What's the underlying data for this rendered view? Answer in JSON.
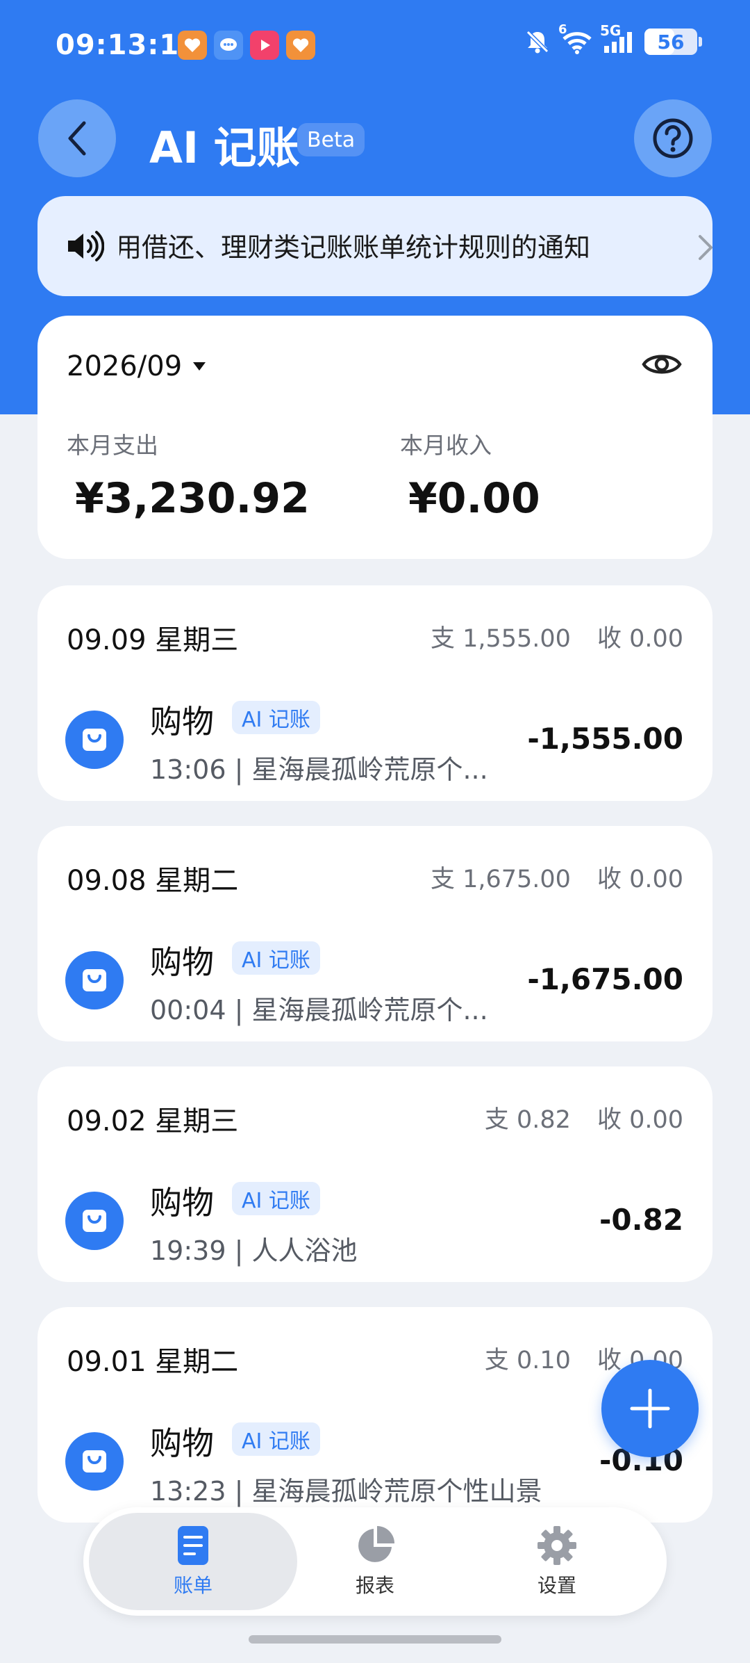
{
  "status_bar": {
    "time": "09:13:13",
    "battery_level": "56",
    "battery_fraction": 0.56,
    "network_label": "5G",
    "wifi_badge": "6",
    "notification_icons": [
      "heart-app-icon",
      "chat-bubble-icon",
      "video-play-icon",
      "heart-app-icon"
    ]
  },
  "header": {
    "title": "AI 记账",
    "beta_label": "Beta"
  },
  "notice": {
    "text": "用借还、理财类记账账单统计规则的通知"
  },
  "summary": {
    "month": "2026/09",
    "expense_label": "本月支出",
    "expense_value": "¥3,230.92",
    "income_label": "本月收入",
    "income_value": "¥0.00"
  },
  "days": [
    {
      "date": "09.09 星期三",
      "expense_total": "支 1,555.00",
      "income_total": "收 0.00",
      "tx": {
        "category": "购物",
        "tag": "AI 记账",
        "desc": "13:06 | 星海晨孤岭荒原个...",
        "amount": "-1,555.00"
      }
    },
    {
      "date": "09.08 星期二",
      "expense_total": "支 1,675.00",
      "income_total": "收 0.00",
      "tx": {
        "category": "购物",
        "tag": "AI 记账",
        "desc": "00:04 | 星海晨孤岭荒原个...",
        "amount": "-1,675.00"
      }
    },
    {
      "date": "09.02 星期三",
      "expense_total": "支 0.82",
      "income_total": "收 0.00",
      "tx": {
        "category": "购物",
        "tag": "AI 记账",
        "desc": "19:39 | 人人浴池",
        "amount": "-0.82"
      }
    },
    {
      "date": "09.01 星期二",
      "expense_total": "支 0.10",
      "income_total": "收 0.00",
      "tx": {
        "category": "购物",
        "tag": "AI 记账",
        "desc": "13:23 | 星海晨孤岭荒原个性山景",
        "amount": "-0.10"
      }
    }
  ],
  "nav": {
    "items": [
      {
        "label": "账单",
        "icon": "bill-icon",
        "active": true
      },
      {
        "label": "报表",
        "icon": "pie-chart-icon",
        "active": false
      },
      {
        "label": "设置",
        "icon": "gear-icon",
        "active": false
      }
    ]
  },
  "colors": {
    "brand_blue": "#2f7bf2",
    "background": "#eef1f6",
    "notice_bg": "#e6efff"
  }
}
